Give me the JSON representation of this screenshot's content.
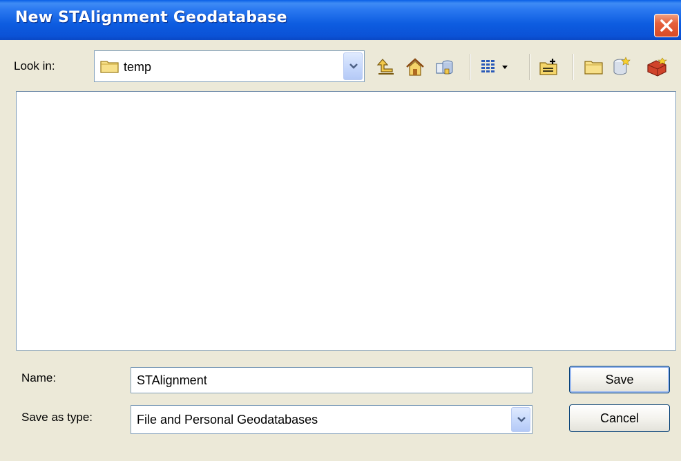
{
  "window": {
    "title": "New STAlignment Geodatabase"
  },
  "lookin": {
    "label": "Look in:",
    "value": "temp"
  },
  "toolbar": {
    "icons": [
      "up-one-level-icon",
      "home-icon",
      "connect-folder-icon",
      "view-menu-icon",
      "new-folder-icon",
      "new-file-geodatabase-icon",
      "new-personal-geodatabase-icon",
      "toolbox-icon"
    ]
  },
  "name": {
    "label": "Name:",
    "value": "STAlignment"
  },
  "save_type": {
    "label": "Save as type:",
    "value": "File and Personal Geodatabases"
  },
  "buttons": {
    "save": "Save",
    "cancel": "Cancel"
  },
  "colors": {
    "titlebar": "#0b52d6",
    "dialog_bg": "#ece9d8",
    "close": "#d84a26"
  }
}
